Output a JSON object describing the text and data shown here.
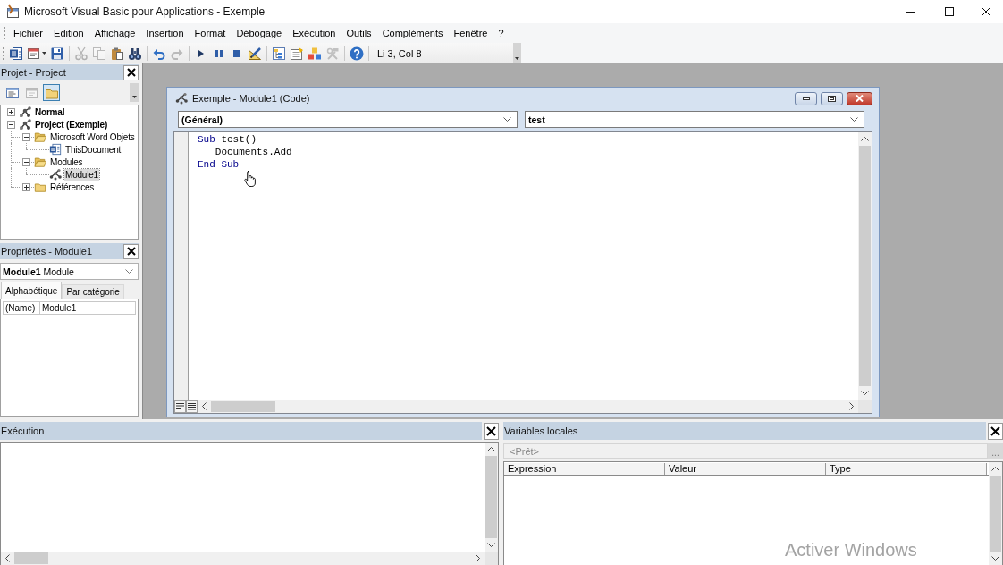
{
  "window": {
    "title": "Microsoft Visual Basic pour Applications - Exemple"
  },
  "menu": [
    {
      "key": "F",
      "post": "ichier"
    },
    {
      "key": "E",
      "post": "dition"
    },
    {
      "key": "A",
      "post": "ffichage"
    },
    {
      "key": "I",
      "post": "nsertion"
    },
    {
      "pre": "Forma",
      "key": "t"
    },
    {
      "key": "D",
      "post": "ébogage"
    },
    {
      "pre": "E",
      "key": "x",
      "post": "écution"
    },
    {
      "key": "O",
      "post": "utils"
    },
    {
      "key": "C",
      "post": "ompléments"
    },
    {
      "pre": "Fe",
      "key": "n",
      "post": "être"
    },
    {
      "key": "?"
    }
  ],
  "toolbar": {
    "groups": [
      [
        {
          "disabled": false
        },
        {
          "disabled": false
        },
        {
          "disabled": false
        }
      ],
      [
        {
          "disabled": true
        },
        {
          "disabled": true
        },
        {
          "disabled": false
        },
        {
          "disabled": false
        }
      ],
      [
        {
          "disabled": false
        },
        {
          "disabled": true
        }
      ],
      [
        {
          "disabled": false
        },
        {
          "disabled": false
        },
        {
          "disabled": false
        },
        {
          "disabled": false
        }
      ],
      [
        {
          "disabled": false
        },
        {
          "disabled": false
        },
        {
          "disabled": false
        },
        {
          "disabled": true
        }
      ],
      [
        {
          "disabled": false
        }
      ]
    ],
    "position": "Li 3, Col 8"
  },
  "project_panel": {
    "title": "Projet - Project",
    "buttons": [
      {
        "disabled": false,
        "pressed": false
      },
      {
        "disabled": true,
        "pressed": false
      },
      {
        "disabled": false,
        "pressed": true
      }
    ],
    "tree": [
      {
        "label": "Normal",
        "kind": "project",
        "expanded": false,
        "selected": false
      },
      {
        "label": "Project (Exemple)",
        "kind": "project",
        "expanded": true,
        "selected": false,
        "children": [
          {
            "label": "Microsoft Word Objets",
            "kind": "folder",
            "expanded": true,
            "selected": false,
            "children": [
              {
                "label": "ThisDocument",
                "kind": "document",
                "selected": false
              }
            ]
          },
          {
            "label": "Modules",
            "kind": "folder",
            "expanded": true,
            "selected": false,
            "children": [
              {
                "label": "Module1",
                "kind": "module",
                "selected": true
              }
            ]
          },
          {
            "label": "Références",
            "kind": "folder",
            "expanded": false,
            "selected": false
          }
        ]
      }
    ]
  },
  "properties_panel": {
    "title": "Propriétés - Module1",
    "object": "**Module1** Module",
    "tabs": [
      {
        "label": "Alphabétique",
        "selected": true
      },
      {
        "label": "Par catégorie",
        "selected": false
      }
    ],
    "rows": [
      {
        "name": "(Name)",
        "value": "Module1"
      }
    ]
  },
  "code_window": {
    "title": "Exemple - Module1 (Code)",
    "object_list": "(Général)",
    "procedure_list": "test",
    "lines": [
      {
        "tokens": [
          {
            "kind": "keyword",
            "text": "Sub"
          },
          {
            "kind": "plain",
            "text": " test()"
          }
        ]
      },
      {
        "tokens": [
          {
            "kind": "plain",
            "text": "   Documents.Add"
          }
        ]
      },
      {
        "tokens": [
          {
            "kind": "keyword",
            "text": "End Sub"
          }
        ]
      }
    ]
  },
  "immediate_panel": {
    "title": "Exécution"
  },
  "locals_panel": {
    "title": "Variables locales",
    "context": "<Prêt>",
    "context_button": "...",
    "columns": [
      "Expression",
      "Valeur",
      "Type"
    ]
  },
  "activation_notice": "Activer Windows"
}
